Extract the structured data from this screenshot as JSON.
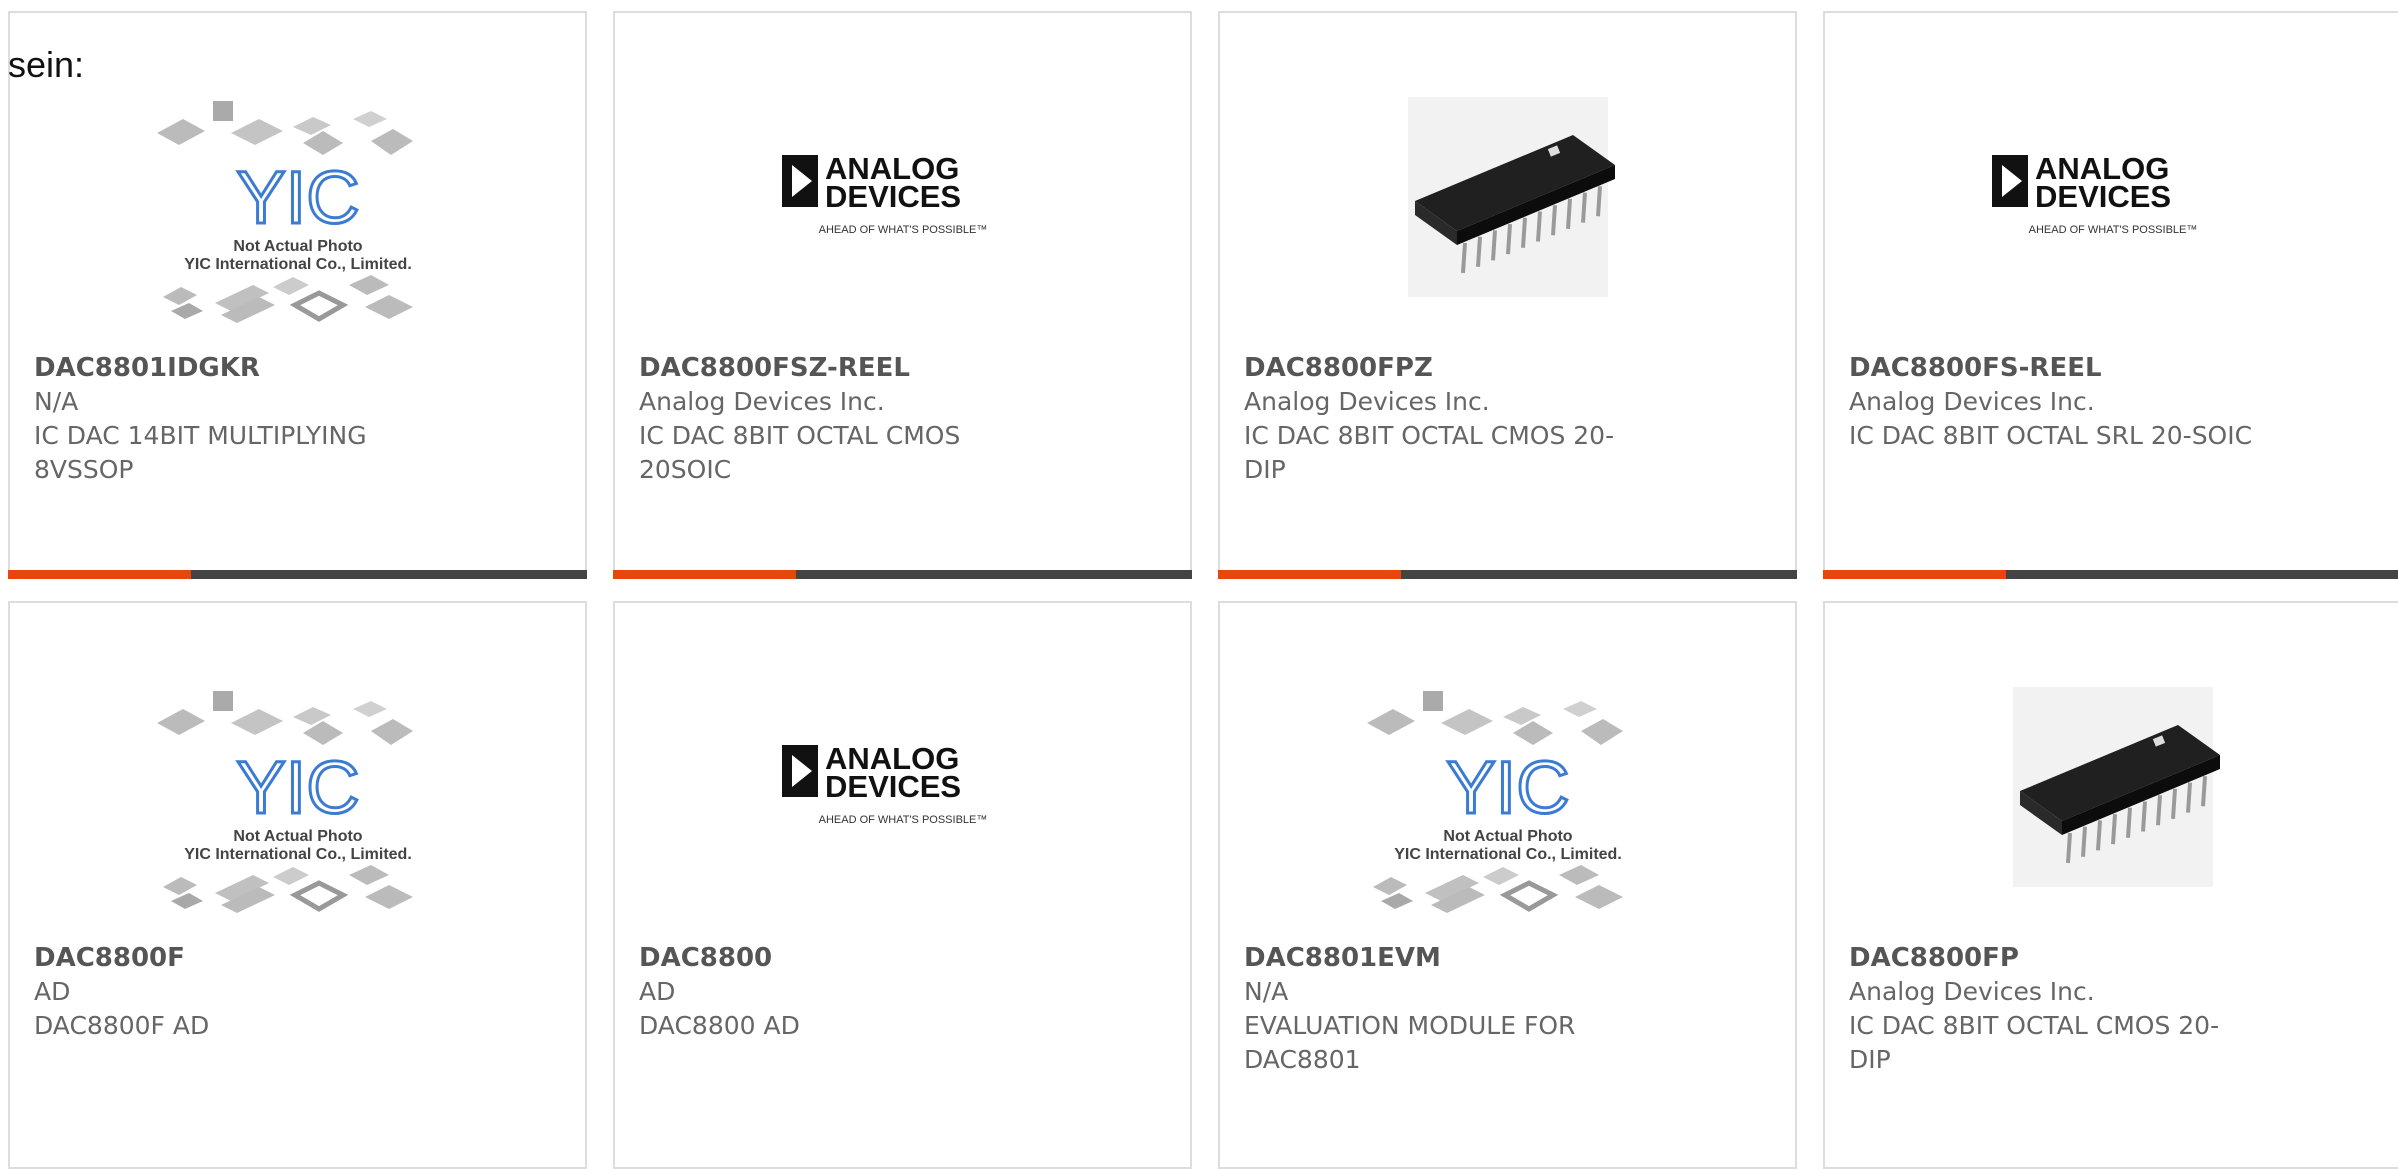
{
  "fragment_text": "sein:",
  "colors": {
    "accent": "#e8460d",
    "bar": "#444444",
    "border": "#dddddd",
    "text": "#666666"
  },
  "placeholder_image": {
    "line1": "Not Actual Photo",
    "line2": "YIC International Co., Limited.",
    "logo": "YIC"
  },
  "analog_logo": {
    "line1": "ANALOG",
    "line2": "DEVICES",
    "tagline": "AHEAD OF WHAT'S POSSIBLE™"
  },
  "products": [
    {
      "part": "DAC8801IDGKR",
      "mfr": "N/A",
      "desc1": "IC DAC 14BIT MULTIPLYING",
      "desc2": "8VSSOP",
      "image": "yic-placeholder",
      "bar": true
    },
    {
      "part": "DAC8800FSZ-REEL",
      "mfr": "Analog Devices Inc.",
      "desc1": "IC DAC 8BIT OCTAL CMOS",
      "desc2": "20SOIC",
      "image": "analog-devices-logo",
      "bar": true
    },
    {
      "part": "DAC8800FPZ",
      "mfr": "Analog Devices Inc.",
      "desc1": "IC DAC 8BIT OCTAL CMOS 20-",
      "desc2": "DIP",
      "image": "dip-chip-photo",
      "bar": true
    },
    {
      "part": "DAC8800FS-REEL",
      "mfr": "Analog Devices Inc.",
      "desc1": "IC DAC 8BIT OCTAL SRL 20-SOIC",
      "desc2": "",
      "image": "analog-devices-logo",
      "bar": true
    },
    {
      "part": "DAC8800F",
      "mfr": "AD",
      "desc1": "DAC8800F AD",
      "desc2": "",
      "image": "yic-placeholder",
      "bar": false
    },
    {
      "part": "DAC8800",
      "mfr": "AD",
      "desc1": "DAC8800 AD",
      "desc2": "",
      "image": "analog-devices-logo",
      "bar": false
    },
    {
      "part": "DAC8801EVM",
      "mfr": "N/A",
      "desc1": "EVALUATION MODULE FOR",
      "desc2": "DAC8801",
      "image": "yic-placeholder",
      "bar": false
    },
    {
      "part": "DAC8800FP",
      "mfr": "Analog Devices Inc.",
      "desc1": "IC DAC 8BIT OCTAL CMOS 20-",
      "desc2": "DIP",
      "image": "dip-chip-photo",
      "bar": false
    }
  ]
}
